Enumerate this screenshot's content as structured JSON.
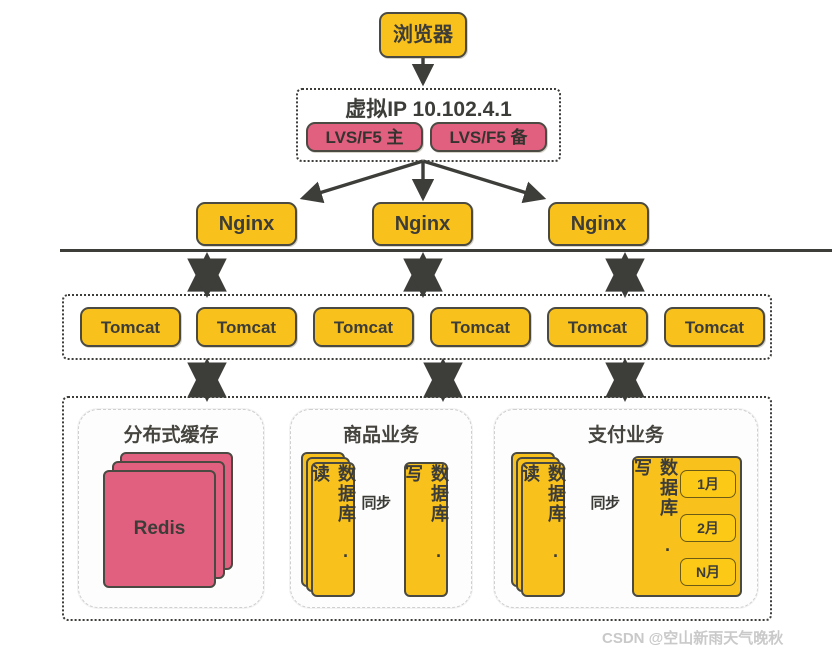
{
  "diagram": {
    "title": "Distributed high-availability web architecture",
    "colors": {
      "node_yellow": "#f8c11c",
      "node_pink": "#e2607f",
      "border_dark": "#4a4a43",
      "arrow": "#3d3d3a",
      "panel_bg": "#fdfdfd"
    }
  },
  "client": {
    "browser_label": "浏览器"
  },
  "lb_layer": {
    "vip_label": "虚拟IP 10.102.4.1",
    "nodes": [
      {
        "label": "LVS/F5 主"
      },
      {
        "label": "LVS/F5 备"
      }
    ]
  },
  "web_layer": {
    "nodes": [
      {
        "label": "Nginx"
      },
      {
        "label": "Nginx"
      },
      {
        "label": "Nginx"
      }
    ]
  },
  "app_layer": {
    "nodes": [
      {
        "label": "Tomcat"
      },
      {
        "label": "Tomcat"
      },
      {
        "label": "Tomcat"
      },
      {
        "label": "Tomcat"
      },
      {
        "label": "Tomcat"
      },
      {
        "label": "Tomcat"
      }
    ]
  },
  "data_layer": {
    "cache": {
      "title": "分布式缓存",
      "node_label": "Redis",
      "stack_count": 3
    },
    "product": {
      "title": "商品业务",
      "read_label": "数据库 · 读",
      "write_label": "数据库 · 写",
      "sync_label": "同步",
      "read_stack_count": 3
    },
    "payment": {
      "title": "支付业务",
      "read_label": "数据库 · 读",
      "write_label": "数据库 · 写",
      "sync_label": "同步",
      "read_stack_count": 3,
      "partitions": [
        {
          "label": "1月"
        },
        {
          "label": "2月"
        },
        {
          "label": "N月"
        }
      ]
    }
  },
  "watermark": {
    "text": "CSDN @空山新雨天气晚秋"
  }
}
